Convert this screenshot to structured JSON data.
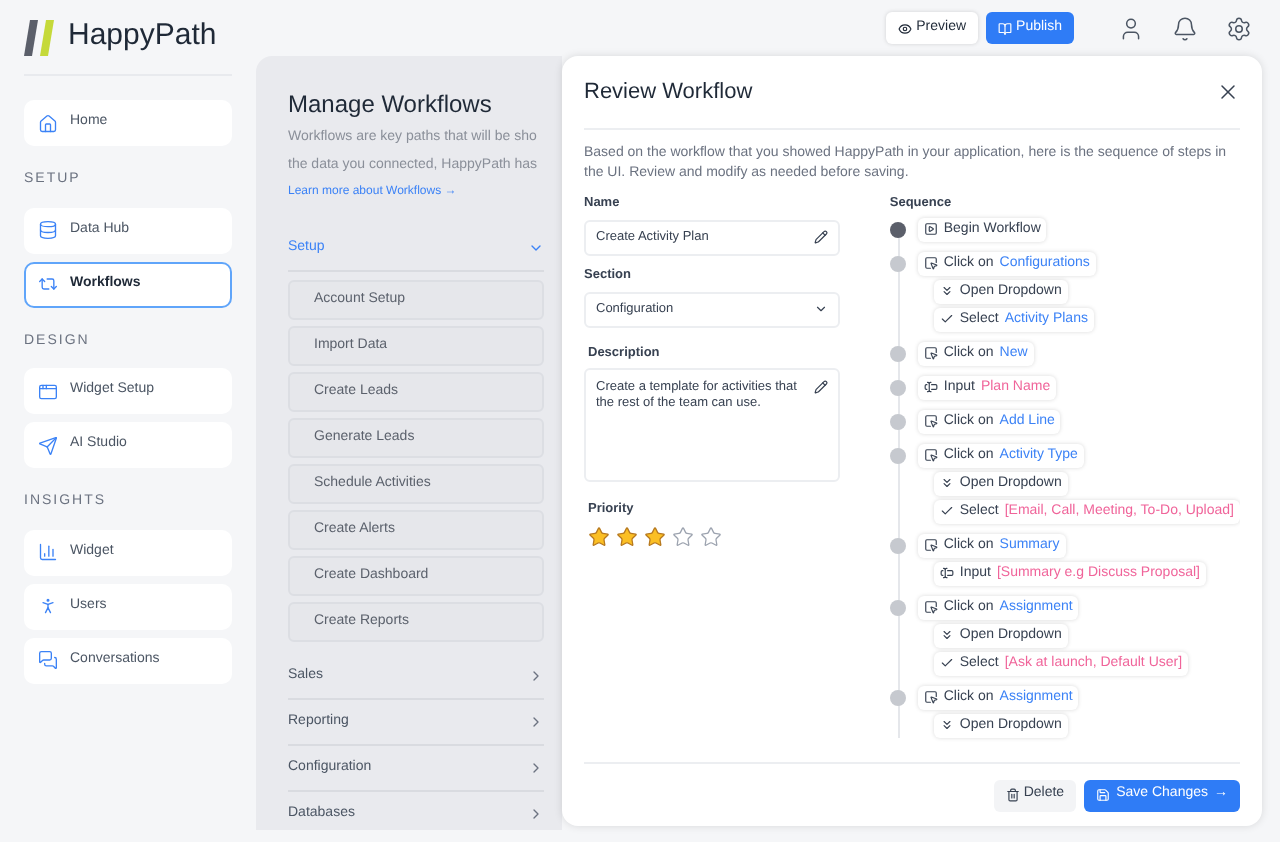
{
  "app": {
    "name": "HappyPath"
  },
  "nav": [
    {
      "items": [
        {
          "label": "Home",
          "selected": false
        }
      ]
    },
    {
      "heading": "SETUP",
      "items": [
        {
          "label": "Data Hub",
          "selected": false
        },
        {
          "label": "Workflows",
          "selected": true
        }
      ]
    },
    {
      "heading": "DESIGN",
      "items": [
        {
          "label": "Widget Setup",
          "selected": false
        },
        {
          "label": "AI Studio",
          "selected": false
        }
      ]
    },
    {
      "heading": "INSIGHTS",
      "items": [
        {
          "label": "Widget",
          "selected": false
        },
        {
          "label": "Users",
          "selected": false
        },
        {
          "label": "Conversations",
          "selected": false
        }
      ]
    }
  ],
  "topbar": {
    "preview": "Preview",
    "publish": "Publish"
  },
  "manage": {
    "title": "Manage Workflows",
    "description": [
      "Workflows are key paths that will be sho",
      "the data you connected, HappyPath has"
    ],
    "link": "Learn more about Workflows →",
    "groups": [
      {
        "label": "Setup",
        "expanded": true,
        "items": [
          "Account Setup",
          "Import Data",
          "Create Leads",
          "Generate Leads",
          "Schedule Activities",
          "Create Alerts",
          "Create Dashboard",
          "Create Reports"
        ]
      },
      {
        "label": "Sales",
        "expanded": false
      },
      {
        "label": "Reporting",
        "expanded": false
      },
      {
        "label": "Configuration",
        "expanded": false
      },
      {
        "label": "Databases",
        "expanded": false
      }
    ]
  },
  "review": {
    "title": "Review Workflow",
    "intro": "Based on the workflow that you showed HappyPath in your application, here is the sequence of steps in the UI. Review and modify as needed before saving.",
    "name": {
      "label": "Name",
      "value": "Create Activity Plan"
    },
    "section": {
      "label": "Section",
      "value": "Configuration"
    },
    "description": {
      "label": "Description",
      "value": "Create a template for activities that the rest of the team can use."
    },
    "priority": {
      "label": "Priority",
      "stars": 3
    },
    "sequence_label": "Sequence",
    "sequence": [
      {
        "kind": "begin",
        "action": "Begin Workflow"
      },
      {
        "kind": "click",
        "action": "Click on",
        "target": "Configurations",
        "color": "#3b82f6",
        "children": [
          {
            "kind": "dropdown",
            "action": "Open Dropdown"
          },
          {
            "kind": "select",
            "action": "Select",
            "target": "Activity Plans",
            "color": "#3b82f6"
          }
        ]
      },
      {
        "kind": "click",
        "action": "Click on",
        "target": "New",
        "color": "#3b82f6"
      },
      {
        "kind": "input",
        "action": "Input",
        "target": "Plan Name",
        "color": "#f0649a"
      },
      {
        "kind": "click",
        "action": "Click on",
        "target": "Add Line",
        "color": "#3b82f6"
      },
      {
        "kind": "click",
        "action": "Click on",
        "target": "Activity Type",
        "color": "#3b82f6",
        "children": [
          {
            "kind": "dropdown",
            "action": "Open Dropdown"
          },
          {
            "kind": "select",
            "action": "Select",
            "target": "[Email, Call, Meeting, To-Do, Upload]",
            "color": "#f0649a"
          }
        ]
      },
      {
        "kind": "click",
        "action": "Click on",
        "target": "Summary",
        "color": "#3b82f6",
        "children": [
          {
            "kind": "input",
            "action": "Input",
            "target": "[Summary e.g Discuss Proposal]",
            "color": "#f0649a"
          }
        ]
      },
      {
        "kind": "click",
        "action": "Click on",
        "target": "Assignment",
        "color": "#3b82f6",
        "children": [
          {
            "kind": "dropdown",
            "action": "Open Dropdown"
          },
          {
            "kind": "select",
            "action": "Select",
            "target": "[Ask at launch, Default User]",
            "color": "#f0649a"
          }
        ]
      },
      {
        "kind": "click",
        "action": "Click on",
        "target": "Assignment",
        "color": "#3b82f6",
        "children": [
          {
            "kind": "dropdown",
            "action": "Open Dropdown"
          }
        ]
      }
    ],
    "buttons": {
      "delete": "Delete",
      "save": "Save Changes",
      "save_arrow": "→"
    }
  }
}
